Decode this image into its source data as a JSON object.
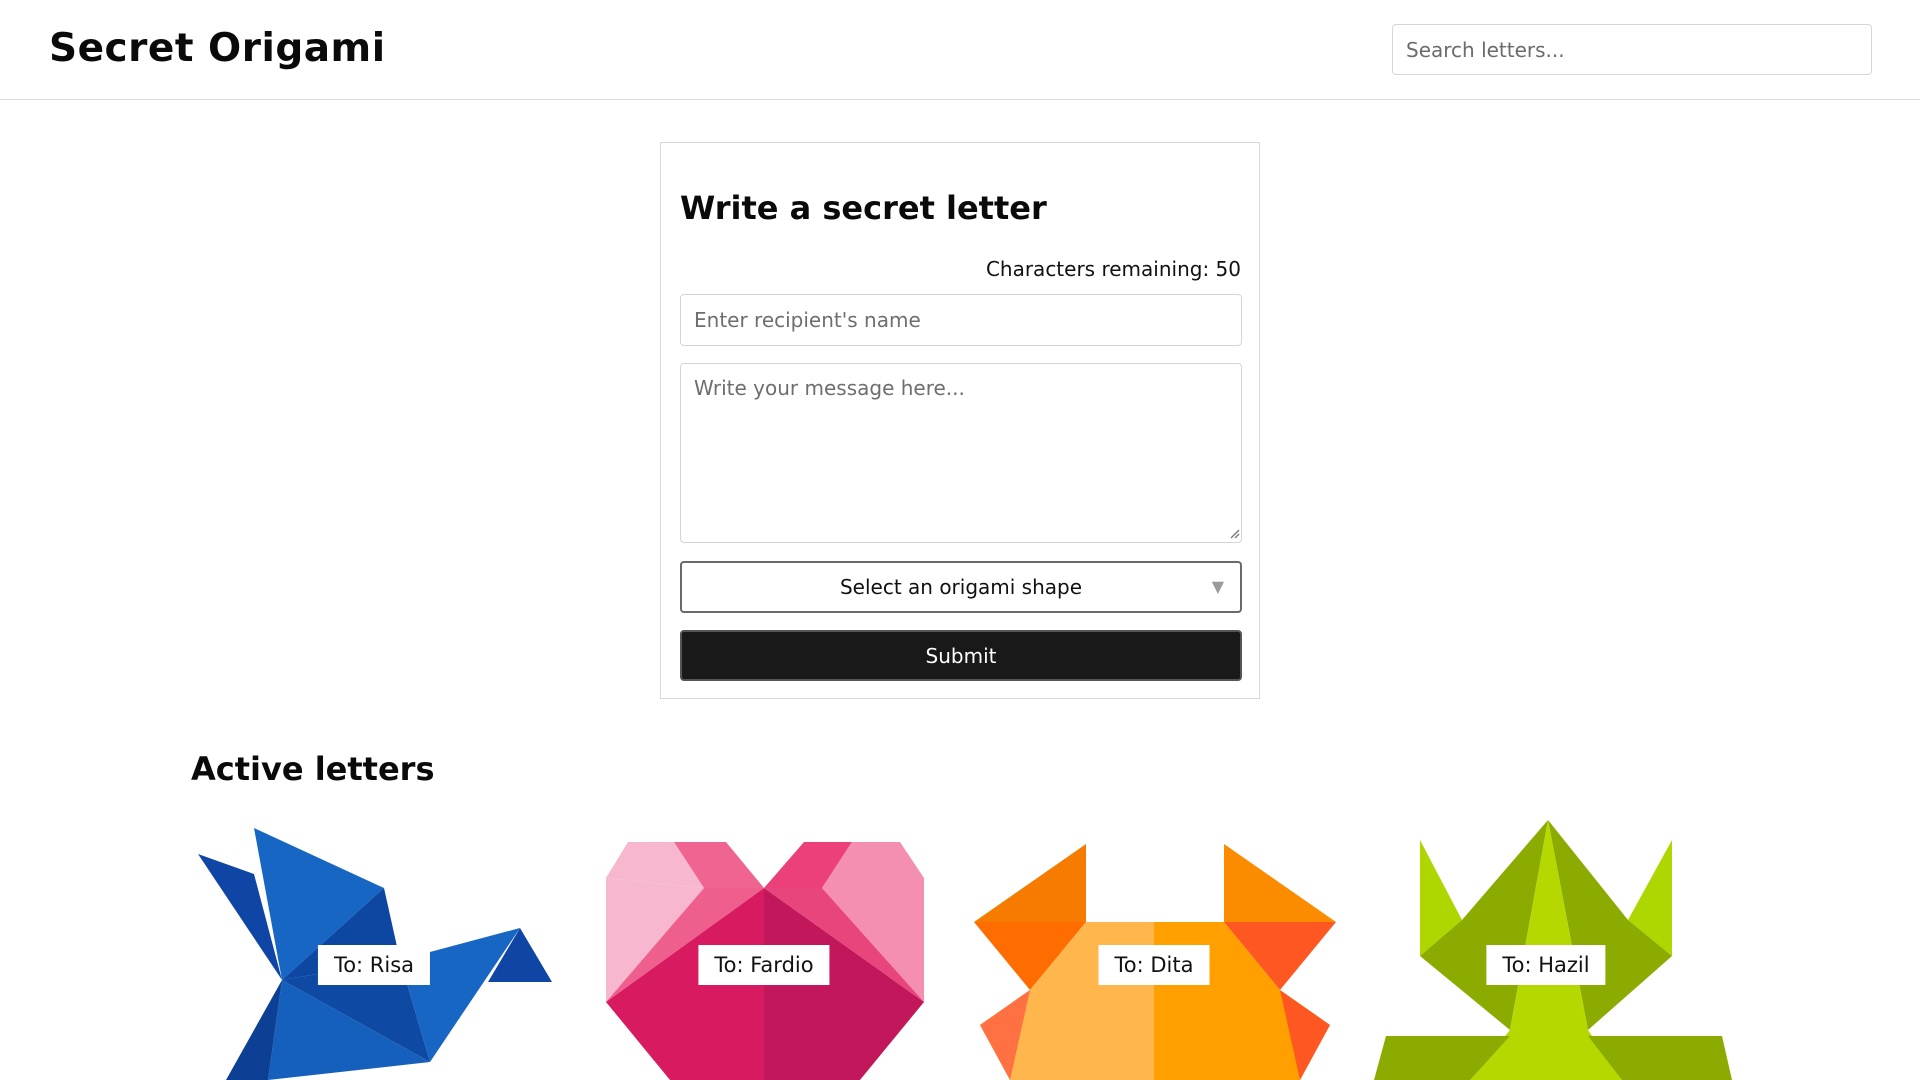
{
  "header": {
    "logo": "Secret Origami",
    "search_placeholder": "Search letters..."
  },
  "form": {
    "title": "Write a secret letter",
    "counter_label": "Characters remaining: 50",
    "recipient_placeholder": "Enter recipient's name",
    "message_placeholder": "Write your message here...",
    "shape_select": "Select an origami shape",
    "submit_label": "Submit"
  },
  "active": {
    "title": "Active letters",
    "letters": [
      {
        "label": "To: Risa",
        "shape": "bird"
      },
      {
        "label": "To: Fardio",
        "shape": "heart"
      },
      {
        "label": "To: Dita",
        "shape": "crab"
      },
      {
        "label": "To: Hazil",
        "shape": "frog"
      }
    ]
  }
}
